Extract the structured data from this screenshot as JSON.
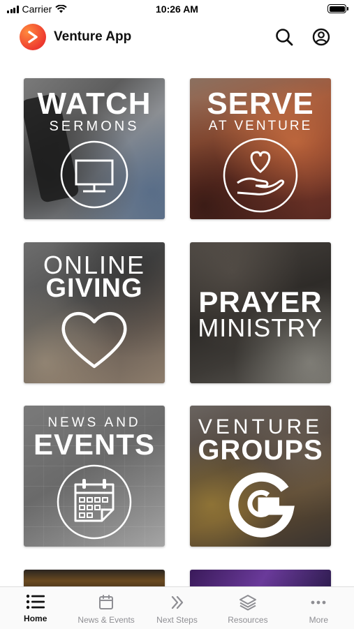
{
  "status_bar": {
    "carrier": "Carrier",
    "time": "10:26 AM"
  },
  "header": {
    "title": "Venture App",
    "search_icon": "search-icon",
    "profile_icon": "account-circle-icon"
  },
  "tiles": [
    {
      "line1": "WATCH",
      "line2": "SERMONS",
      "icon": "tv-icon"
    },
    {
      "line1": "SERVE",
      "line2": "AT VENTURE",
      "icon": "heart-hand-icon"
    },
    {
      "line1": "ONLINE",
      "line2": "GIVING",
      "icon": "heart-icon"
    },
    {
      "line1": "PRAYER",
      "line2": "MINISTRY"
    },
    {
      "line1": "NEWS AND",
      "line2": "EVENTS",
      "icon": "calendar-icon"
    },
    {
      "line1": "VENTURE",
      "line2": "GROUPS",
      "icon": "groups-g-icon"
    }
  ],
  "tabbar": {
    "items": [
      {
        "label": "Home",
        "icon": "list-icon",
        "active": true
      },
      {
        "label": "News & Events",
        "icon": "calendar-icon"
      },
      {
        "label": "Next Steps",
        "icon": "chevrons-right-icon"
      },
      {
        "label": "Resources",
        "icon": "layers-icon"
      },
      {
        "label": "More",
        "icon": "more-dots-icon"
      }
    ]
  },
  "colors": {
    "brand_orange": "#f0532e",
    "active_tab": "#111111",
    "inactive_tab": "#8e8e93"
  }
}
